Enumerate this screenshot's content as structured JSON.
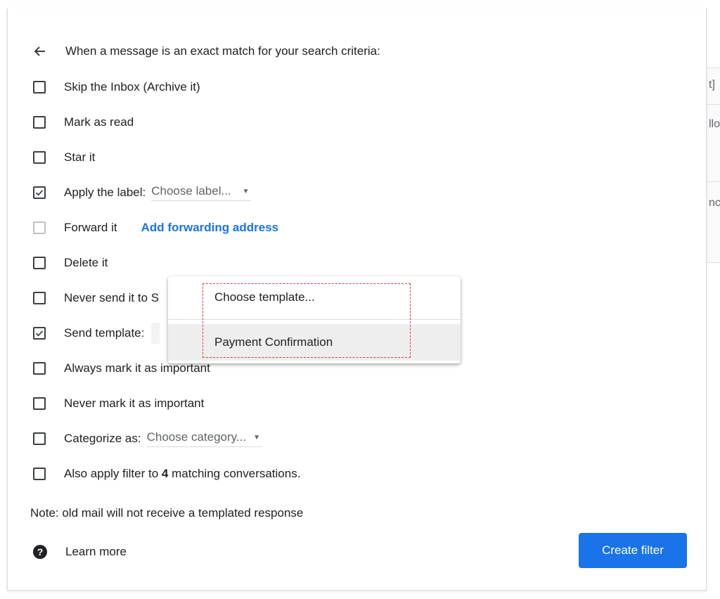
{
  "background": {
    "fragments": [
      "t]",
      "llo",
      "nc"
    ]
  },
  "dialog": {
    "header": "When a message is an exact match for your search criteria:",
    "options": {
      "skip_inbox": {
        "label": "Skip the Inbox (Archive it)",
        "checked": false
      },
      "mark_read": {
        "label": "Mark as read",
        "checked": false
      },
      "star": {
        "label": "Star it",
        "checked": false
      },
      "apply_label": {
        "label": "Apply the label:",
        "checked": true,
        "select_value": "Choose label..."
      },
      "forward": {
        "label": "Forward it",
        "checked": false,
        "disabled": true,
        "link": "Add forwarding address"
      },
      "delete": {
        "label": "Delete it",
        "checked": false
      },
      "never_spam": {
        "label": "Never send it to S",
        "checked": false
      },
      "send_template": {
        "label": "Send template:",
        "checked": true
      },
      "always_important": {
        "label": "Always mark it as important",
        "checked": false
      },
      "never_important": {
        "label": "Never mark it as important",
        "checked": false
      },
      "categorize": {
        "label": "Categorize as:",
        "checked": false,
        "select_value": "Choose category..."
      },
      "also_apply": {
        "label_prefix": "Also apply filter to",
        "count": "4",
        "label_suffix": "matching conversations.",
        "checked": false
      }
    },
    "note": "Note: old mail will not receive a templated response",
    "learn_more": "Learn more",
    "create_button": "Create filter"
  },
  "template_menu": {
    "items": [
      "Choose template...",
      "Payment Confirmation"
    ],
    "selected_index": 1
  },
  "colors": {
    "accent": "#1a73e8",
    "highlight_border": "#e0393e"
  }
}
